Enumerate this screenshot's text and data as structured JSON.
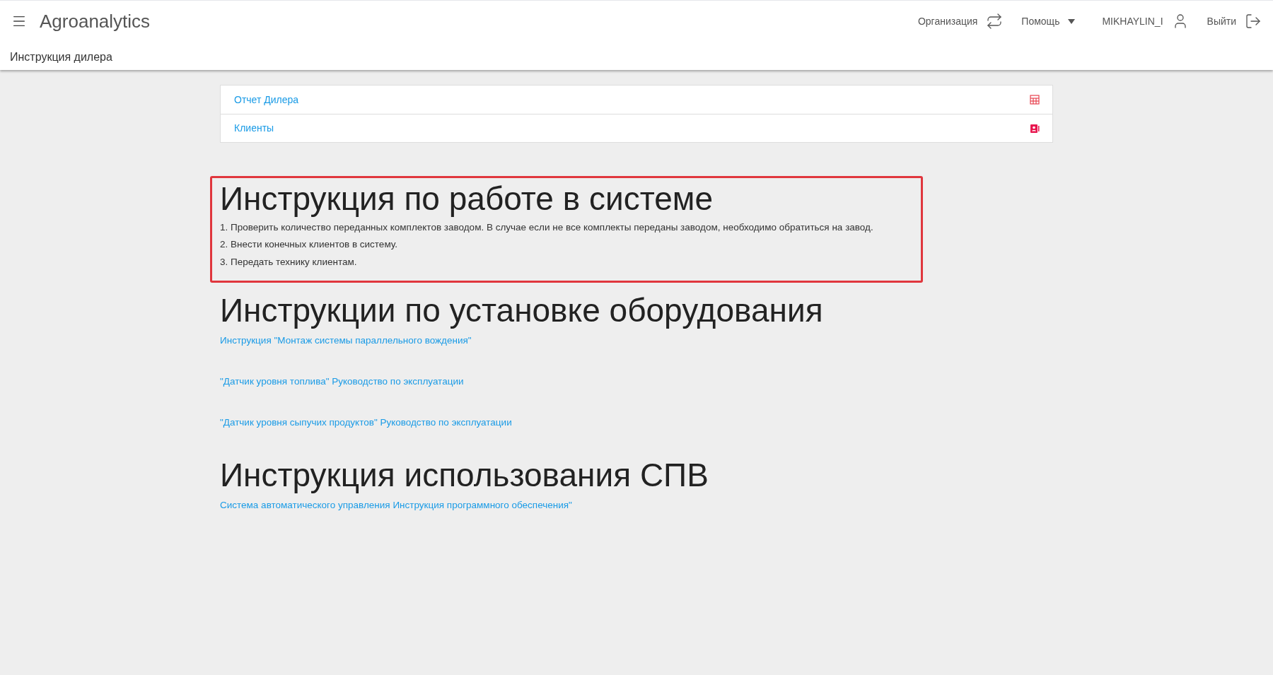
{
  "header": {
    "app_title": "Agroanalytics",
    "page_title": "Инструкция дилера",
    "organization": "Организация",
    "help": "Помощь",
    "user": "MIKHAYLIN_I",
    "logout": "Выйти"
  },
  "menu": [
    {
      "label": "Отчет Дилера",
      "kind": "table"
    },
    {
      "label": "Клиенты",
      "kind": "contacts"
    }
  ],
  "sections": [
    {
      "title": "Инструкция по работе в системе",
      "highlighted": true,
      "kind": "steps",
      "items": [
        "1. Проверить количество переданных комплектов заводом. В случае если не все комплекты переданы заводом, необходимо обратиться на завод.",
        "2. Внести конечных клиентов в систему.",
        "3. Передать технику клиентам."
      ]
    },
    {
      "title": "Инструкции по установке оборудования",
      "highlighted": false,
      "kind": "links",
      "items": [
        "Инструкция \"Монтаж системы параллельного вождения\"",
        "\"Датчик уровня топлива\" Руководство по эксплуатации",
        "\"Датчик уровня сыпучих продуктов\" Руководство по эксплуатации"
      ]
    },
    {
      "title": "Инструкция использования СПВ",
      "highlighted": false,
      "kind": "links",
      "items": [
        "Система автоматического управления Инструкция программного обеспечения\""
      ]
    }
  ]
}
